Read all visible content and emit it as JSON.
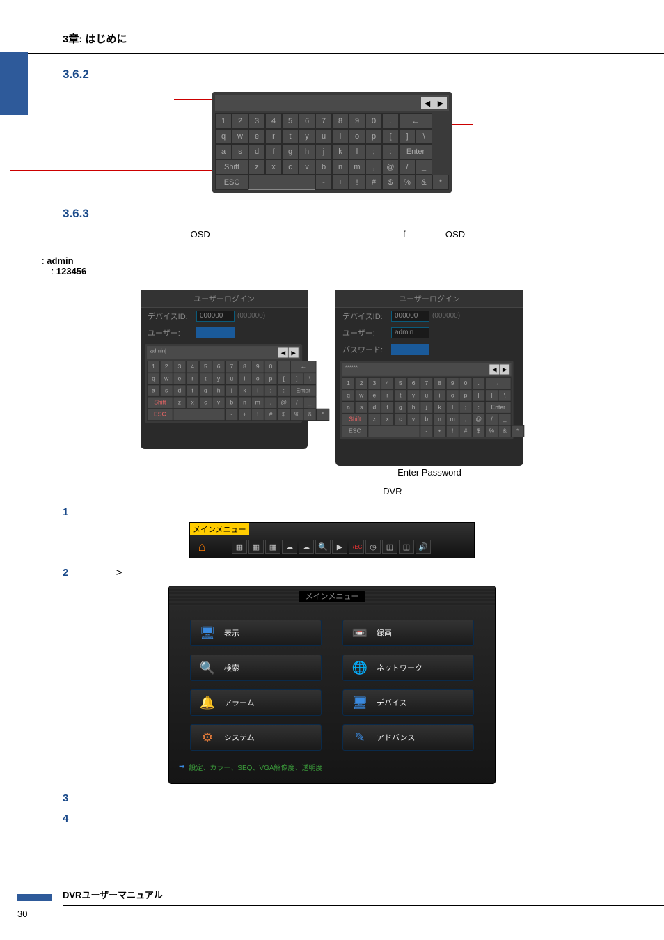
{
  "header": {
    "chapter": "3章: はじめに"
  },
  "sections": {
    "s1": "3.6.2",
    "s2": "3.6.3"
  },
  "body": {
    "text362_para": "",
    "text363_para1_a": "OSD",
    "text363_para1_b": "f",
    "text363_para1_c": "OSD",
    "cred_label_user_prefix": ": ",
    "cred_user": "admin",
    "cred_label_pass_prefix": ": ",
    "cred_pass": "123456",
    "login_title": "ユーザーログイン",
    "login_deviceid_label": "デバイスID:",
    "login_deviceid_value": "000000",
    "login_deviceid_hint": "(000000)",
    "login_user_label": "ユーザー:",
    "login_user_value_admin": "admin",
    "login_pass_label": "パスワード:",
    "login_pass_masked": "******",
    "enter_password_caption": "Enter Password",
    "dvr_text": "DVR"
  },
  "keyboard": {
    "row1": [
      "1",
      "2",
      "3",
      "4",
      "5",
      "6",
      "7",
      "8",
      "9",
      "0",
      "."
    ],
    "row2": [
      "q",
      "w",
      "e",
      "r",
      "t",
      "y",
      "u",
      "i",
      "o",
      "p",
      "[",
      "]",
      "\\"
    ],
    "row3": [
      "a",
      "s",
      "d",
      "f",
      "g",
      "h",
      "j",
      "k",
      "l",
      ";",
      ":"
    ],
    "row4_shift": "Shift",
    "row4": [
      "z",
      "x",
      "c",
      "v",
      "b",
      "n",
      "m",
      ","
    ],
    "row4_at": "@",
    "row4_tail": [
      "/",
      "_"
    ],
    "row5_esc": "ESC",
    "row5_space": " ",
    "row5_tail": [
      "-",
      "+",
      "!",
      "#",
      "$",
      "%",
      "&",
      "*"
    ],
    "enter": "Enter",
    "backspace": "←"
  },
  "steps": {
    "s1": "1",
    "s1_gt": "",
    "s2": "2",
    "s2_gt": ">",
    "s3": "3",
    "s4": "4"
  },
  "toolbar": {
    "title": "メインメニュー",
    "icons": [
      "grid4-icon",
      "grid9-icon",
      "grid16-icon",
      "cloud1-icon",
      "cloud2-icon",
      "zoom-icon",
      "play-icon",
      "rec-icon",
      "timer-icon",
      "pip1-icon",
      "pip2-icon",
      "sound-icon"
    ]
  },
  "menu": {
    "title": "メインメニュー",
    "items": [
      {
        "label": "表示",
        "icon": "display-icon"
      },
      {
        "label": "録画",
        "icon": "record-icon"
      },
      {
        "label": "検索",
        "icon": "search-icon"
      },
      {
        "label": "ネットワーク",
        "icon": "network-icon"
      },
      {
        "label": "アラーム",
        "icon": "alarm-icon"
      },
      {
        "label": "デバイス",
        "icon": "device-icon"
      },
      {
        "label": "システム",
        "icon": "system-icon"
      },
      {
        "label": "アドバンス",
        "icon": "advance-icon"
      }
    ],
    "footer": "設定、カラー、SEQ、VGA解像度、透明度"
  },
  "footer": {
    "text": "DVRユーザーマニュアル",
    "page": "30"
  }
}
